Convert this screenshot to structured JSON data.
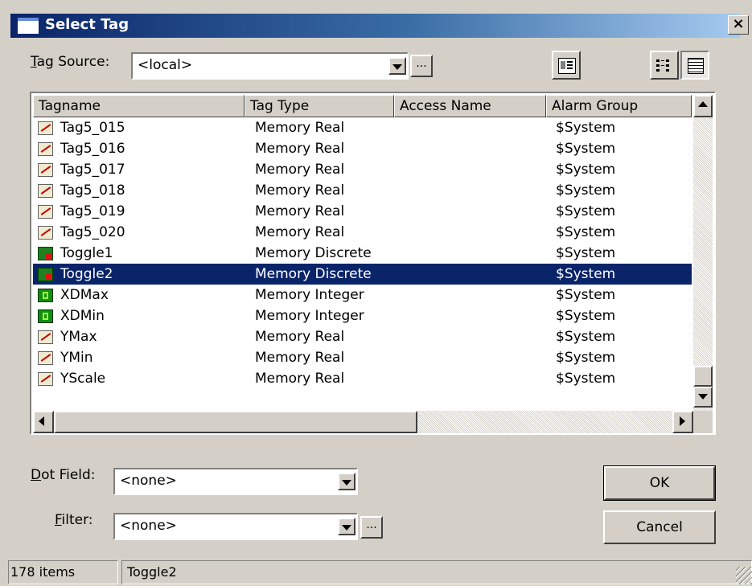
{
  "window": {
    "title": "Select Tag",
    "close": "×"
  },
  "tag_source": {
    "label_prefix": "T",
    "label_rest": "ag Source:",
    "value": "<local>",
    "browse": "..."
  },
  "columns": [
    "Tagname",
    "Tag Type",
    "Access Name",
    "Alarm Group"
  ],
  "rows": [
    {
      "name": "Tag5_015",
      "type": "Memory Real",
      "access": "",
      "group": "$System",
      "icon": "real"
    },
    {
      "name": "Tag5_016",
      "type": "Memory Real",
      "access": "",
      "group": "$System",
      "icon": "real"
    },
    {
      "name": "Tag5_017",
      "type": "Memory Real",
      "access": "",
      "group": "$System",
      "icon": "real"
    },
    {
      "name": "Tag5_018",
      "type": "Memory Real",
      "access": "",
      "group": "$System",
      "icon": "real"
    },
    {
      "name": "Tag5_019",
      "type": "Memory Real",
      "access": "",
      "group": "$System",
      "icon": "real"
    },
    {
      "name": "Tag5_020",
      "type": "Memory Real",
      "access": "",
      "group": "$System",
      "icon": "real"
    },
    {
      "name": "Toggle1",
      "type": "Memory Discrete",
      "access": "",
      "group": "$System",
      "icon": "discrete"
    },
    {
      "name": "Toggle2",
      "type": "Memory Discrete",
      "access": "",
      "group": "$System",
      "icon": "discrete",
      "selected": true
    },
    {
      "name": "XDMax",
      "type": "Memory Integer",
      "access": "",
      "group": "$System",
      "icon": "integer"
    },
    {
      "name": "XDMin",
      "type": "Memory Integer",
      "access": "",
      "group": "$System",
      "icon": "integer"
    },
    {
      "name": "YMax",
      "type": "Memory Real",
      "access": "",
      "group": "$System",
      "icon": "real"
    },
    {
      "name": "YMin",
      "type": "Memory Real",
      "access": "",
      "group": "$System",
      "icon": "real"
    },
    {
      "name": "YScale",
      "type": "Memory Real",
      "access": "",
      "group": "$System",
      "icon": "real"
    }
  ],
  "dot_field": {
    "label_prefix": "D",
    "label_rest": "ot Field:",
    "value": "<none>"
  },
  "filter": {
    "label_prefix": "F",
    "label_rest": "ilter:",
    "value": "<none>",
    "browse": "..."
  },
  "buttons": {
    "ok": "OK",
    "cancel": "Cancel"
  },
  "status": {
    "count": "178 items",
    "selected": "Toggle2"
  },
  "colors": {
    "selection": "#0a246a",
    "face": "#d4d0c8"
  }
}
